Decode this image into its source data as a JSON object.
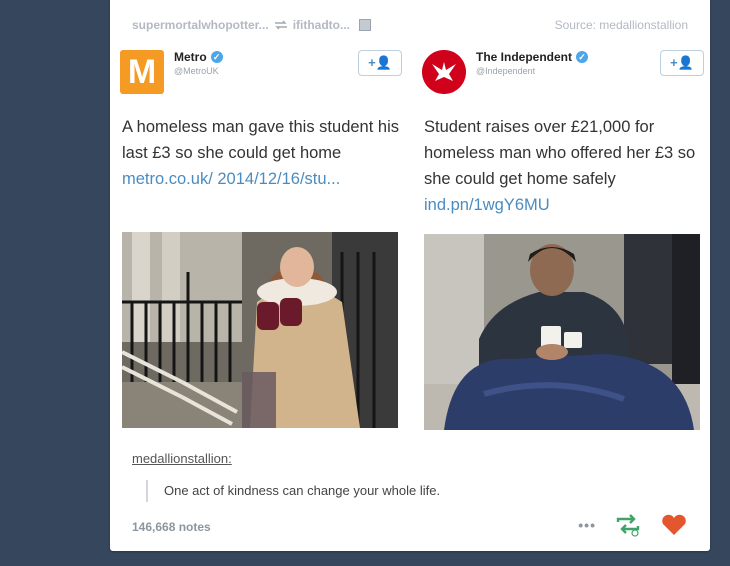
{
  "header": {
    "reblogger_user": "supermortalwhopotter...",
    "source_user": "ifithadto...",
    "source_label": "Source: medallionstallion"
  },
  "left_tweet": {
    "account_name": "Metro",
    "handle": "@MetroUK",
    "logo_letter": "M",
    "follow_label": "+👤",
    "text": "A homeless man gave this student his last £3 so she could get home",
    "link": "metro.co.uk/ 2014/12/16/stu..."
  },
  "right_tweet": {
    "account_name": "The Independent",
    "handle": "@Independent",
    "follow_label": "+👤",
    "text": "Student raises over £21,000 for homeless man who offered her £3 so she could get home safely",
    "link": "ind.pn/1wgY6MU"
  },
  "caption": {
    "user": "medallionstallion",
    "suffix": ":",
    "quote": "One act of kindness can change your whole life."
  },
  "footer": {
    "notes": "146,668 notes",
    "more_label": "•••"
  },
  "colors": {
    "dashboard_bg": "#36465d",
    "link": "#4a8cc0",
    "like": "#e4572e",
    "reblog": "#3fa46a"
  }
}
